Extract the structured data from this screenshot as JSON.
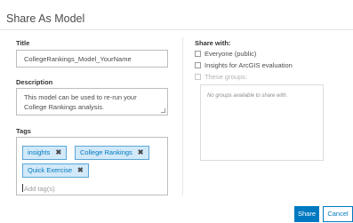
{
  "dialog": {
    "title": "Share As Model"
  },
  "form": {
    "title_label": "Title",
    "title_value": "CollegeRankings_Model_YourName",
    "description_label": "Description",
    "description_value": "This model can be used to re-run your College Rankings analysis.",
    "tags_label": "Tags",
    "tags": [
      {
        "label": "insights"
      },
      {
        "label": "College Rankings"
      },
      {
        "label": "Quick Exercise"
      }
    ],
    "tag_remove_glyph": "✖",
    "add_tag_placeholder": "Add tag(s)"
  },
  "share": {
    "label": "Share with:",
    "options": [
      {
        "label": "Everyone (public)",
        "checked": false,
        "enabled": true
      },
      {
        "label": "Insights for ArcGIS evaluation",
        "checked": false,
        "enabled": true
      },
      {
        "label": "These groups:",
        "checked": false,
        "enabled": false
      }
    ],
    "groups_empty": "No groups available to share with."
  },
  "buttons": {
    "share_label": "Share",
    "cancel_label": "Cancel"
  },
  "colors": {
    "accent": "#0079c1",
    "tag_bg": "#d2e9f9"
  }
}
